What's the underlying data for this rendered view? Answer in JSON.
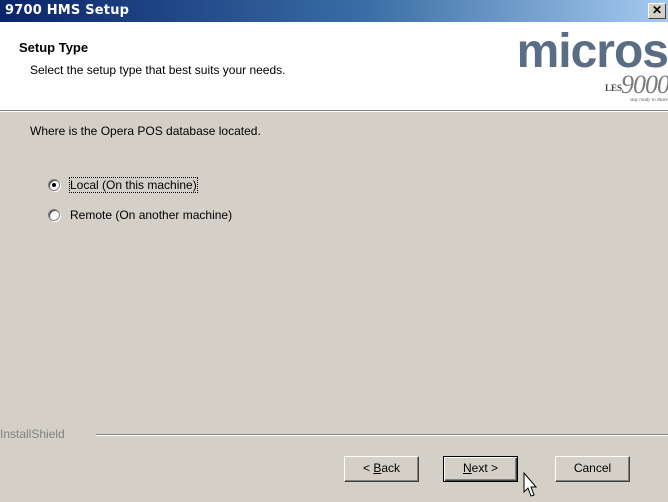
{
  "window": {
    "title": "9700 HMS Setup",
    "close_glyph": "✕"
  },
  "header": {
    "title": "Setup Type",
    "subtitle": "Select the setup type that best suits your needs.",
    "logo": {
      "brand": "micros",
      "les": "LES",
      "number": "9000",
      "tagline": "stay ready to share"
    }
  },
  "question": "Where is the Opera POS database located.",
  "options": [
    {
      "label": "Local (On this machine)",
      "selected": true
    },
    {
      "label": "Remote (On another machine)",
      "selected": false
    }
  ],
  "group_label": "InstallShield",
  "buttons": {
    "back": {
      "underline": "B",
      "rest": "ack",
      "prefix": "< "
    },
    "next": {
      "underline": "N",
      "rest": "ext",
      "suffix": " >"
    },
    "cancel": "Cancel"
  }
}
